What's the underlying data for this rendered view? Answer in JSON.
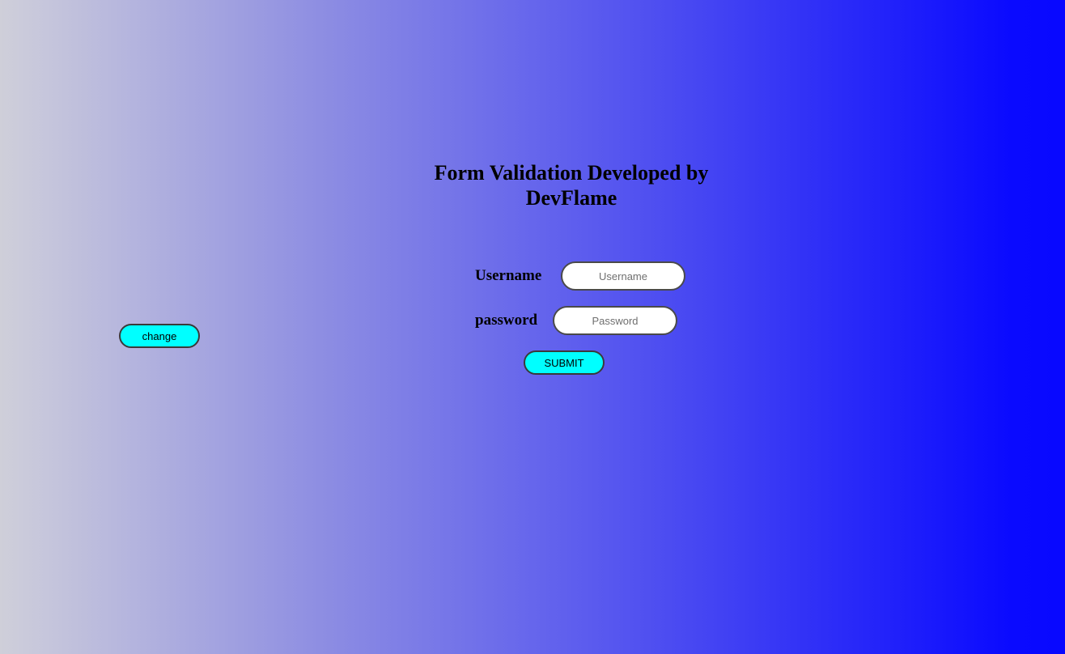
{
  "page": {
    "background_gradient": [
      "#cfcfd9",
      "#8e8ee2",
      "#6666ec",
      "#3333f6",
      "#0808ff"
    ]
  },
  "title": "Form Validation Developed by DevFlame",
  "form": {
    "username_label": "Username",
    "username_placeholder": "Username",
    "password_label": "password",
    "password_placeholder": "Password",
    "submit_label": "SUBMIT"
  },
  "change_button": {
    "label": "change"
  },
  "colors": {
    "button_fill": "#00ffff",
    "input_fill": "#ffffff",
    "border": "#3a3a3a"
  }
}
